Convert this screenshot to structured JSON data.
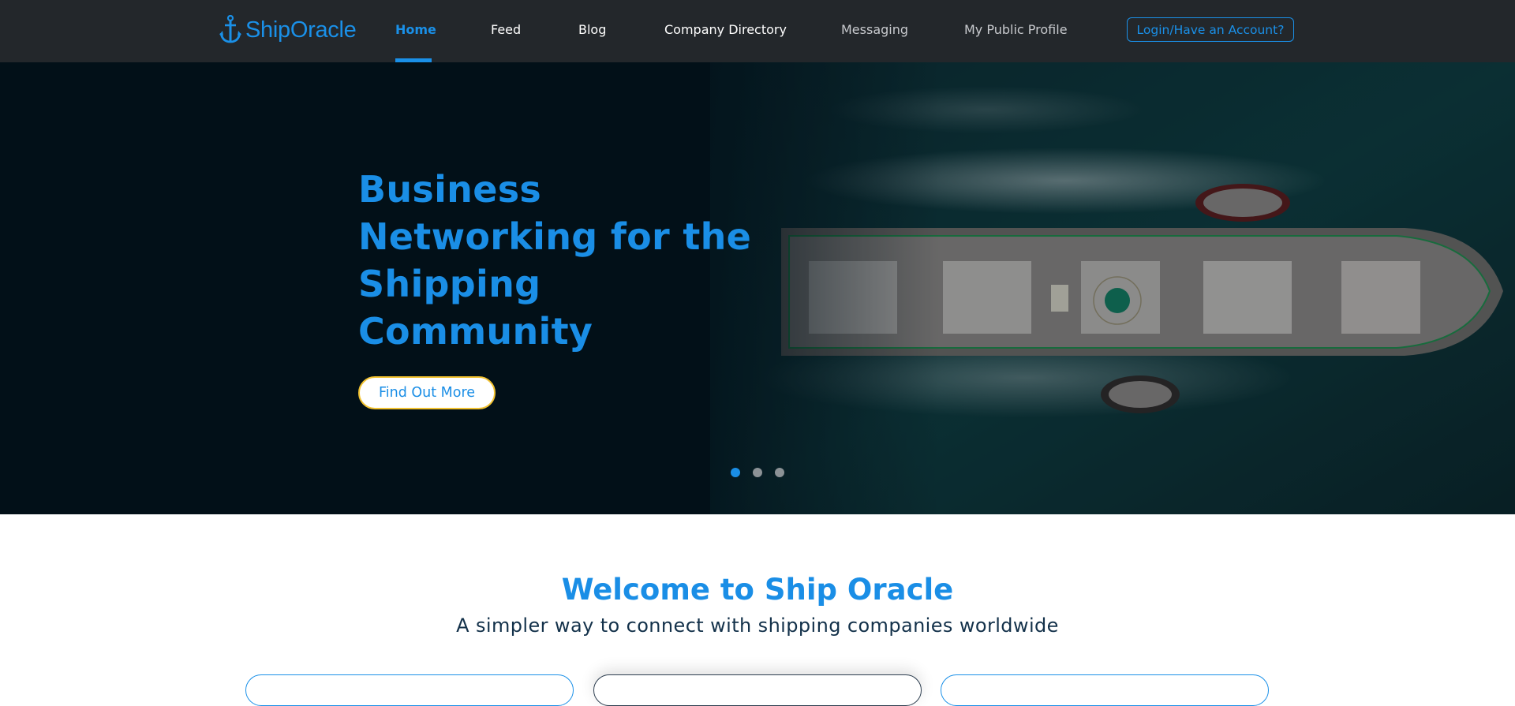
{
  "nav": {
    "logo_text": "ShipOracle",
    "items": [
      {
        "label": "Home",
        "state": "active"
      },
      {
        "label": "Feed"
      },
      {
        "label": "Blog"
      },
      {
        "label": "Company Directory"
      },
      {
        "label": "Messaging"
      },
      {
        "label": "My Public Profile"
      }
    ],
    "login_label": "Login/Have an Account?"
  },
  "hero": {
    "title_lines": [
      "Business",
      "Networking for the",
      "Shipping",
      "Community"
    ],
    "cta_label": "Find Out More",
    "slides_total": 3,
    "active_slide": 1
  },
  "welcome": {
    "title": "Welcome to Ship Oracle",
    "subtitle": "A simpler way to connect with shipping companies worldwide"
  },
  "colors": {
    "brand_blue": "#1a8ee6",
    "nav_bg": "#23272b",
    "hero_bg": "#021019",
    "cta_border": "#f2c230"
  }
}
